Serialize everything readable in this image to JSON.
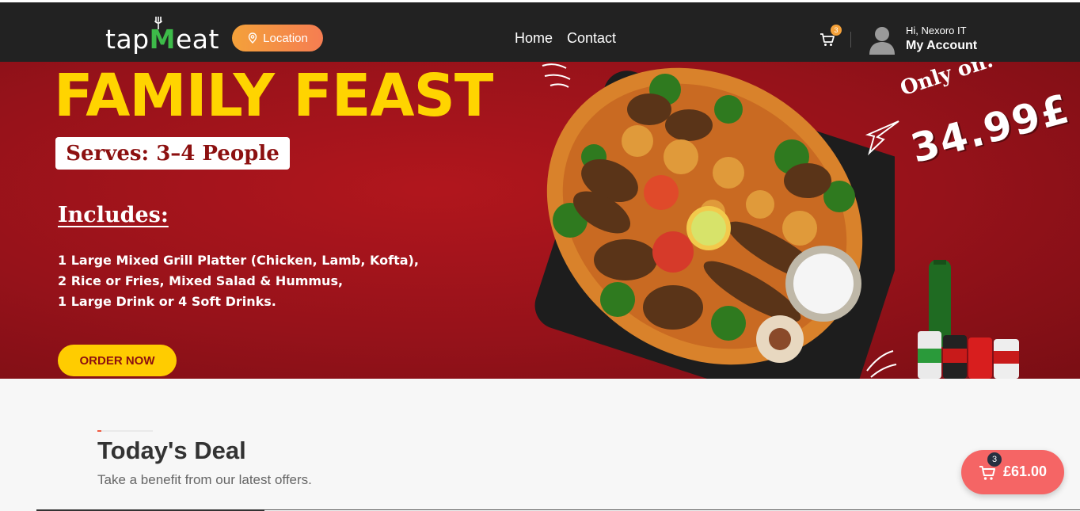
{
  "header": {
    "logo_prefix": "tap",
    "logo_highlight": "M",
    "logo_suffix": "eat",
    "location_label": "Location",
    "nav": [
      {
        "label": "Home"
      },
      {
        "label": "Contact"
      }
    ],
    "cart_count": "3",
    "greeting": "Hi, Nexoro IT",
    "account_label": "My Account"
  },
  "banner": {
    "headline": "FAMILY FEAST",
    "serves": "Serves: 3–4 People",
    "includes_title": "Includes:",
    "includes_lines": [
      "1 Large Mixed Grill Platter (Chicken, Lamb, Kofta),",
      "2 Rice or Fries, Mixed Salad & Hummus,",
      "1 Large Drink or 4 Soft Drinks."
    ],
    "order_button": "ORDER NOW",
    "only_on": "Only on:",
    "price": "34.99£"
  },
  "deals": {
    "title": "Today's Deal",
    "subtitle": "Take a benefit from our latest offers."
  },
  "floating_cart": {
    "count": "3",
    "total": "£61.00"
  },
  "colors": {
    "header_bg": "#222222",
    "brand_green": "#3dbb49",
    "location_orange": "#f4a13a",
    "banner_red": "#96121a",
    "headline_yellow": "#ffd400",
    "cart_red": "#f56565"
  }
}
